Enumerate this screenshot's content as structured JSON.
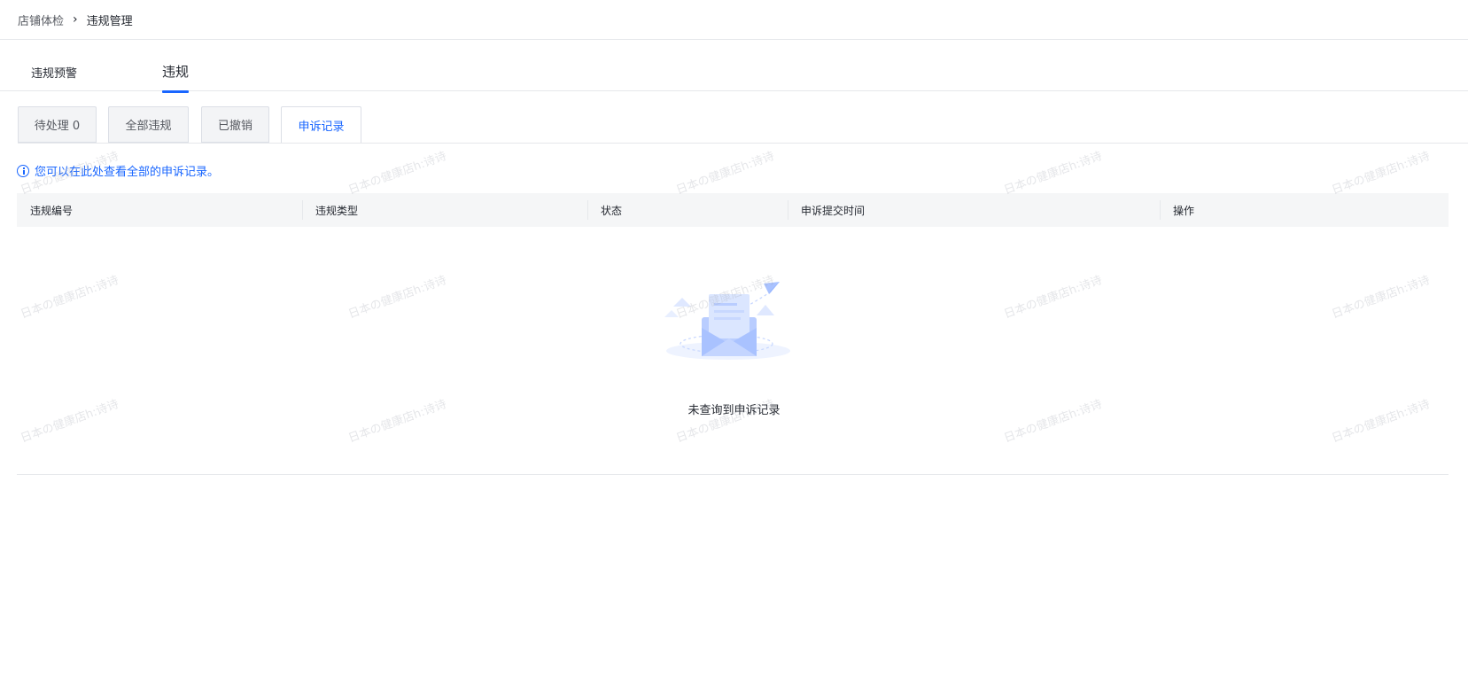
{
  "breadcrumb": {
    "parent": "店铺体检",
    "separator": "›",
    "current": "违规管理"
  },
  "main_tabs": [
    {
      "label": "违规预警",
      "active": false
    },
    {
      "label": "违规",
      "active": true
    }
  ],
  "sub_tabs": [
    {
      "label": "待处理 0",
      "active": false
    },
    {
      "label": "全部违规",
      "active": false
    },
    {
      "label": "已撤销",
      "active": false
    },
    {
      "label": "申诉记录",
      "active": true
    }
  ],
  "notice": {
    "icon": "info-icon",
    "text": "您可以在此处查看全部的申诉记录。"
  },
  "table": {
    "columns": [
      "违规编号",
      "违规类型",
      "状态",
      "申诉提交时间",
      "操作"
    ],
    "rows": []
  },
  "empty_state": {
    "icon": "empty-mail-icon",
    "text": "未查询到申诉记录"
  },
  "watermark": {
    "text": "日本の健康店h:诗诗"
  },
  "colors": {
    "accent": "#1966ff",
    "text": "#252931",
    "muted": "#565960",
    "header_bg": "#f5f6f7",
    "border": "#e6e8eb"
  }
}
